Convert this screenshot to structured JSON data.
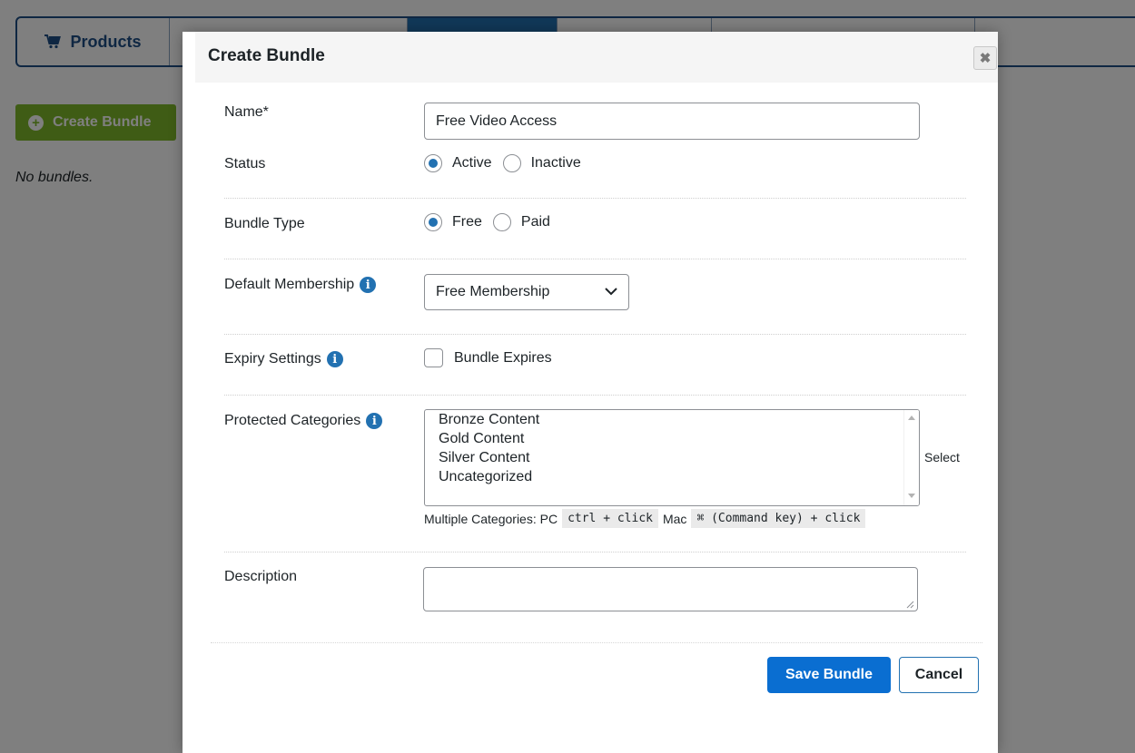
{
  "background": {
    "tabs": [
      {
        "label": "Products",
        "icon": "cart-icon"
      }
    ],
    "create_button_label": "Create Bundle",
    "empty_message": "No bundles."
  },
  "modal": {
    "title": "Create Bundle",
    "close_icon": "close-icon",
    "fields": {
      "name": {
        "label": "Name*",
        "value": "Free Video Access"
      },
      "status": {
        "label": "Status",
        "options": [
          "Active",
          "Inactive"
        ],
        "selected": "Active"
      },
      "bundle_type": {
        "label": "Bundle Type",
        "options": [
          "Free",
          "Paid"
        ],
        "selected": "Free"
      },
      "default_membership": {
        "label": "Default Membership",
        "selected": "Free Membership",
        "icon": "info-icon"
      },
      "expiry_settings": {
        "label": "Expiry Settings",
        "checkbox_label": "Bundle Expires",
        "checked": false,
        "icon": "info-icon"
      },
      "protected_categories": {
        "label": "Protected Categories",
        "icon": "info-icon",
        "options": [
          "Bronze Content",
          "Gold Content",
          "Silver Content",
          "Uncategorized"
        ],
        "side_text": "Select",
        "hint": {
          "prefix": "Multiple Categories: PC",
          "pc_keys": "ctrl + click",
          "mac_label": "Mac",
          "mac_keys": "⌘ (Command key) + click"
        }
      },
      "description": {
        "label": "Description",
        "value": ""
      }
    },
    "buttons": {
      "save": "Save Bundle",
      "cancel": "Cancel"
    }
  },
  "colors": {
    "primary": "#0a6ed1",
    "accent_blue": "#2271b1",
    "create_green": "#7fb92b",
    "overlay": "rgba(0,0,0,0.5)"
  }
}
